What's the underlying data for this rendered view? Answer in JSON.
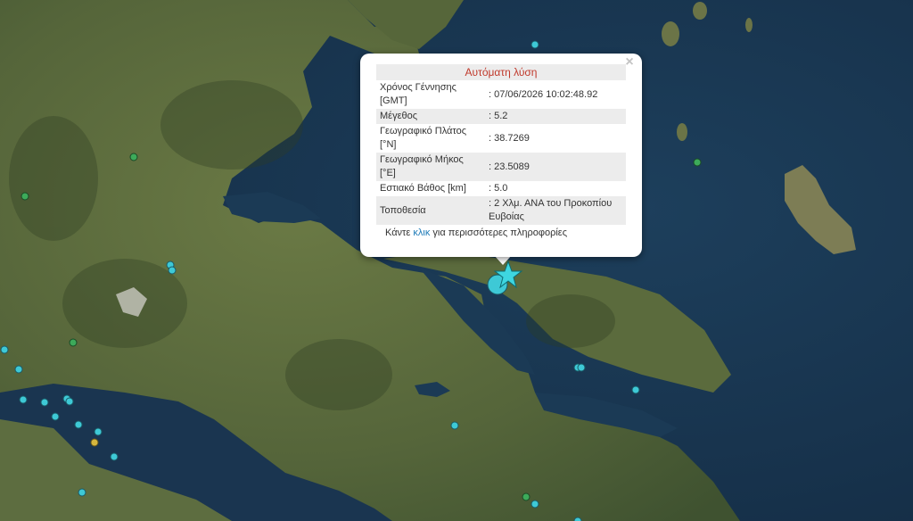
{
  "popup": {
    "title": "Αυτόματη λύση",
    "close_label": "×",
    "rows": [
      {
        "label": "Χρόνος Γέννησης [GMT]",
        "value": ": 07/06/2026 10:02:48.92"
      },
      {
        "label": "Μέγεθος",
        "value": ": 5.2"
      },
      {
        "label": "Γεωγραφικό Πλάτος [°N]",
        "value": ": 38.7269"
      },
      {
        "label": "Γεωγραφικό Μήκος [°E]",
        "value": ": 23.5089"
      },
      {
        "label": "Εστιακό Βάθος [km]",
        "value": ": 5.0"
      },
      {
        "label": "Τοποθεσία",
        "value": ": 2 Χλμ. ΑΝΑ του Προκοπίου Ευβοίας"
      }
    ],
    "more_prefix": "Κάντε",
    "more_link": "κλικ",
    "more_suffix": "για περισσότερες πληροφορίες"
  },
  "colors": {
    "sea": "#1a3a55",
    "land": "#5a6a3c",
    "marker_cyan": "#3ec9d6",
    "marker_green": "#3daa5a",
    "marker_yellow": "#d6b73e",
    "epicenter_star": "#3ed6e0",
    "title_red": "#c0392b"
  },
  "icons": {
    "epicenter": "star-icon",
    "close": "close-icon"
  }
}
